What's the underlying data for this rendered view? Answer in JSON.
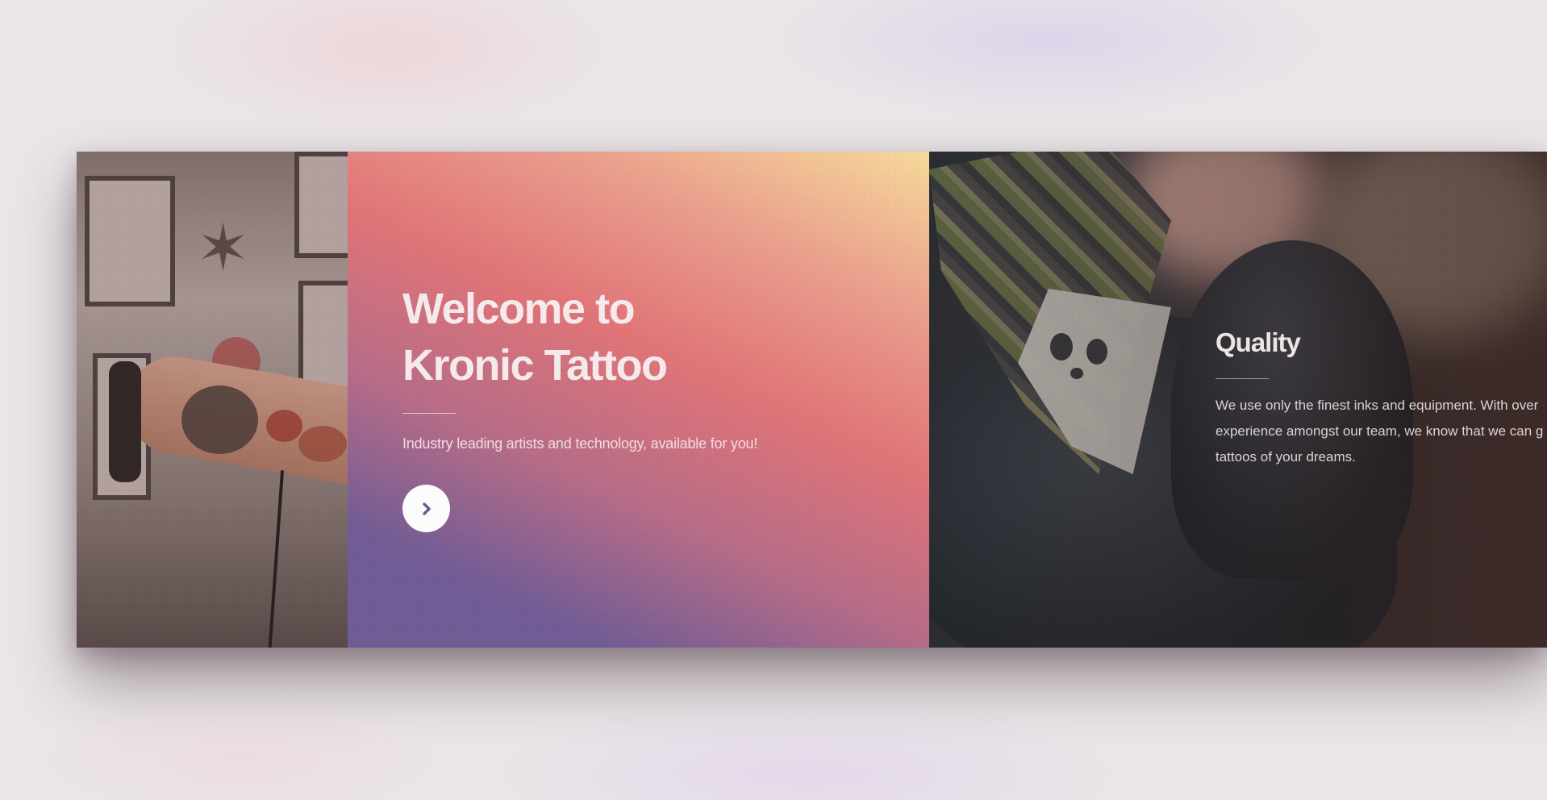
{
  "hero": {
    "title": "Welcome to\nKronic Tattoo",
    "subtitle": "Industry leading artists and technology, available for you!",
    "button_icon": "chevron-right-icon"
  },
  "feature": {
    "title": "Quality",
    "body_lines": [
      "We use only the finest inks and equipment. With over",
      "experience amongst our team, we know that we can g",
      "tattoos of your dreams."
    ]
  },
  "colors": {
    "gradient_top_right": "#f9dc9c",
    "gradient_mid": "#e37679",
    "gradient_bottom_left": "#6f5f97",
    "button_icon": "#6b5b95"
  }
}
